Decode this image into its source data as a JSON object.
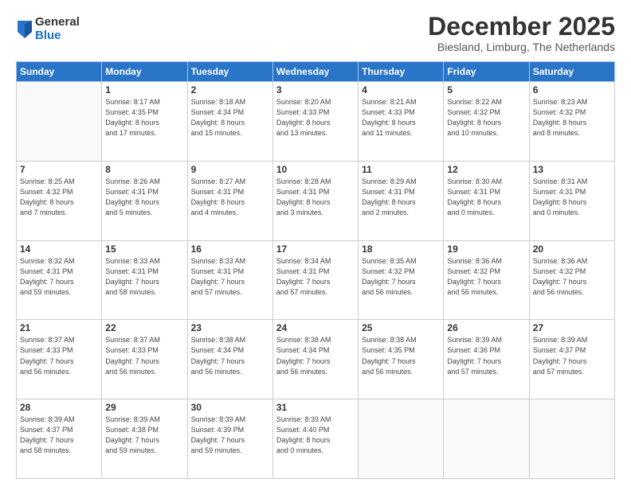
{
  "logo": {
    "general": "General",
    "blue": "Blue"
  },
  "title": "December 2025",
  "location": "Biesland, Limburg, The Netherlands",
  "days_header": [
    "Sunday",
    "Monday",
    "Tuesday",
    "Wednesday",
    "Thursday",
    "Friday",
    "Saturday"
  ],
  "weeks": [
    [
      {
        "num": "",
        "info": ""
      },
      {
        "num": "1",
        "info": "Sunrise: 8:17 AM\nSunset: 4:35 PM\nDaylight: 8 hours\nand 17 minutes."
      },
      {
        "num": "2",
        "info": "Sunrise: 8:18 AM\nSunset: 4:34 PM\nDaylight: 8 hours\nand 15 minutes."
      },
      {
        "num": "3",
        "info": "Sunrise: 8:20 AM\nSunset: 4:33 PM\nDaylight: 8 hours\nand 13 minutes."
      },
      {
        "num": "4",
        "info": "Sunrise: 8:21 AM\nSunset: 4:33 PM\nDaylight: 8 hours\nand 11 minutes."
      },
      {
        "num": "5",
        "info": "Sunrise: 8:22 AM\nSunset: 4:32 PM\nDaylight: 8 hours\nand 10 minutes."
      },
      {
        "num": "6",
        "info": "Sunrise: 8:23 AM\nSunset: 4:32 PM\nDaylight: 8 hours\nand 8 minutes."
      }
    ],
    [
      {
        "num": "7",
        "info": "Sunrise: 8:25 AM\nSunset: 4:32 PM\nDaylight: 8 hours\nand 7 minutes."
      },
      {
        "num": "8",
        "info": "Sunrise: 8:26 AM\nSunset: 4:31 PM\nDaylight: 8 hours\nand 5 minutes."
      },
      {
        "num": "9",
        "info": "Sunrise: 8:27 AM\nSunset: 4:31 PM\nDaylight: 8 hours\nand 4 minutes."
      },
      {
        "num": "10",
        "info": "Sunrise: 8:28 AM\nSunset: 4:31 PM\nDaylight: 8 hours\nand 3 minutes."
      },
      {
        "num": "11",
        "info": "Sunrise: 8:29 AM\nSunset: 4:31 PM\nDaylight: 8 hours\nand 2 minutes."
      },
      {
        "num": "12",
        "info": "Sunrise: 8:30 AM\nSunset: 4:31 PM\nDaylight: 8 hours\nand 0 minutes."
      },
      {
        "num": "13",
        "info": "Sunrise: 8:31 AM\nSunset: 4:31 PM\nDaylight: 8 hours\nand 0 minutes."
      }
    ],
    [
      {
        "num": "14",
        "info": "Sunrise: 8:32 AM\nSunset: 4:31 PM\nDaylight: 7 hours\nand 59 minutes."
      },
      {
        "num": "15",
        "info": "Sunrise: 8:33 AM\nSunset: 4:31 PM\nDaylight: 7 hours\nand 58 minutes."
      },
      {
        "num": "16",
        "info": "Sunrise: 8:33 AM\nSunset: 4:31 PM\nDaylight: 7 hours\nand 57 minutes."
      },
      {
        "num": "17",
        "info": "Sunrise: 8:34 AM\nSunset: 4:31 PM\nDaylight: 7 hours\nand 57 minutes."
      },
      {
        "num": "18",
        "info": "Sunrise: 8:35 AM\nSunset: 4:32 PM\nDaylight: 7 hours\nand 56 minutes."
      },
      {
        "num": "19",
        "info": "Sunrise: 8:36 AM\nSunset: 4:32 PM\nDaylight: 7 hours\nand 56 minutes."
      },
      {
        "num": "20",
        "info": "Sunrise: 8:36 AM\nSunset: 4:32 PM\nDaylight: 7 hours\nand 56 minutes."
      }
    ],
    [
      {
        "num": "21",
        "info": "Sunrise: 8:37 AM\nSunset: 4:33 PM\nDaylight: 7 hours\nand 56 minutes."
      },
      {
        "num": "22",
        "info": "Sunrise: 8:37 AM\nSunset: 4:33 PM\nDaylight: 7 hours\nand 56 minutes."
      },
      {
        "num": "23",
        "info": "Sunrise: 8:38 AM\nSunset: 4:34 PM\nDaylight: 7 hours\nand 56 minutes."
      },
      {
        "num": "24",
        "info": "Sunrise: 8:38 AM\nSunset: 4:34 PM\nDaylight: 7 hours\nand 56 minutes."
      },
      {
        "num": "25",
        "info": "Sunrise: 8:38 AM\nSunset: 4:35 PM\nDaylight: 7 hours\nand 56 minutes."
      },
      {
        "num": "26",
        "info": "Sunrise: 8:39 AM\nSunset: 4:36 PM\nDaylight: 7 hours\nand 57 minutes."
      },
      {
        "num": "27",
        "info": "Sunrise: 8:39 AM\nSunset: 4:37 PM\nDaylight: 7 hours\nand 57 minutes."
      }
    ],
    [
      {
        "num": "28",
        "info": "Sunrise: 8:39 AM\nSunset: 4:37 PM\nDaylight: 7 hours\nand 58 minutes."
      },
      {
        "num": "29",
        "info": "Sunrise: 8:39 AM\nSunset: 4:38 PM\nDaylight: 7 hours\nand 59 minutes."
      },
      {
        "num": "30",
        "info": "Sunrise: 8:39 AM\nSunset: 4:39 PM\nDaylight: 7 hours\nand 59 minutes."
      },
      {
        "num": "31",
        "info": "Sunrise: 8:39 AM\nSunset: 4:40 PM\nDaylight: 8 hours\nand 0 minutes."
      },
      {
        "num": "",
        "info": ""
      },
      {
        "num": "",
        "info": ""
      },
      {
        "num": "",
        "info": ""
      }
    ]
  ]
}
